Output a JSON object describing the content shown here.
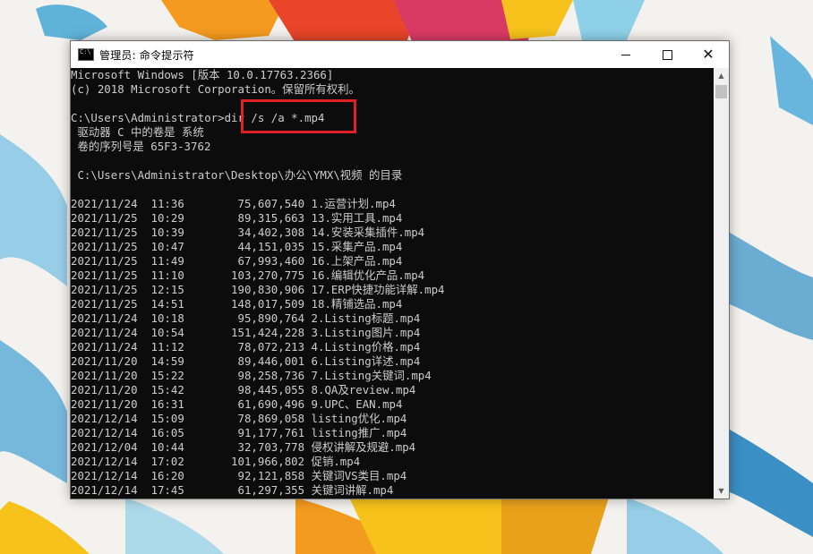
{
  "window": {
    "title": "管理员: 命令提示符",
    "app_icon": "cmd-icon",
    "buttons": {
      "minimize_icon": "minimize-icon",
      "maximize_icon": "maximize-icon",
      "close_icon": "close-icon"
    }
  },
  "console": {
    "lines": [
      "Microsoft Windows [版本 10.0.17763.2366]",
      "(c) 2018 Microsoft Corporation。保留所有权利。",
      "",
      "C:\\Users\\Administrator>dir /s /a *.mp4",
      " 驱动器 C 中的卷是 系统",
      " 卷的序列号是 65F3-3762",
      "",
      " C:\\Users\\Administrator\\Desktop\\办公\\YMX\\视频 的目录",
      "",
      "2021/11/24  11:36        75,607,540 1.运营计划.mp4",
      "2021/11/25  10:29        89,315,663 13.实用工具.mp4",
      "2021/11/25  10:39        34,402,308 14.安装采集插件.mp4",
      "2021/11/25  10:47        44,151,035 15.采集产品.mp4",
      "2021/11/25  11:49        67,993,460 16.上架产品.mp4",
      "2021/11/25  11:10       103,270,775 16.编辑优化产品.mp4",
      "2021/11/25  12:15       190,830,906 17.ERP快捷功能详解.mp4",
      "2021/11/25  14:51       148,017,509 18.精铺选品.mp4",
      "2021/11/24  10:18        95,890,764 2.Listing标题.mp4",
      "2021/11/24  10:54       151,424,228 3.Listing图片.mp4",
      "2021/11/24  11:12        78,072,213 4.Listing价格.mp4",
      "2021/11/20  14:59        89,446,001 6.Listing详述.mp4",
      "2021/11/20  15:22        98,258,736 7.Listing关键词.mp4",
      "2021/11/20  15:42        98,445,055 8.QA及review.mp4",
      "2021/11/20  16:31        61,690,496 9.UPC、EAN.mp4",
      "2021/12/14  15:09        78,869,058 listing优化.mp4",
      "2021/12/14  16:05        91,177,761 listing推广.mp4",
      "2021/12/04  10:44        32,703,778 侵权讲解及规避.mp4",
      "2021/12/14  17:02       101,966,802 促销.mp4",
      "2021/12/14  16:20        92,121,858 关键词VS类目.mp4",
      "2021/12/14  17:45        61,297,355 关键词讲解.mp4"
    ]
  },
  "colors": {
    "console_bg": "#0c0c0c",
    "console_fg": "#cccccc",
    "highlight": "#e02020"
  }
}
